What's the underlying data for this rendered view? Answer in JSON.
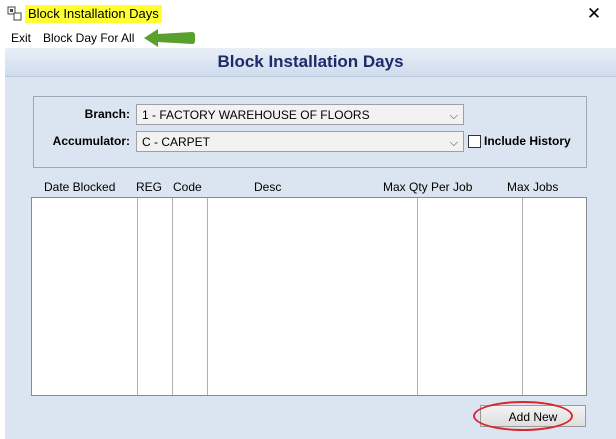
{
  "window": {
    "title": "Block Installation Days",
    "close_glyph": "✕"
  },
  "menu": {
    "items": [
      "Exit",
      "Block Day For All"
    ]
  },
  "page": {
    "title": "Block Installation Days"
  },
  "filters": {
    "branch_label": "Branch:",
    "branch_value": "1  - FACTORY WAREHOUSE OF FLOORS",
    "accumulator_label": "Accumulator:",
    "accumulator_value": "C - CARPET",
    "include_history_label": "Include History",
    "include_history_checked": false
  },
  "grid": {
    "columns": [
      "Date Blocked",
      "REG",
      "Code",
      "Desc",
      "Max Qty Per Job",
      "Max Jobs"
    ],
    "rows": []
  },
  "buttons": {
    "add_new": "Add New"
  },
  "annotations": {
    "arrow_color": "#5aa02c",
    "circle_color": "#d9262a",
    "highlight_color": "#ffff33"
  }
}
